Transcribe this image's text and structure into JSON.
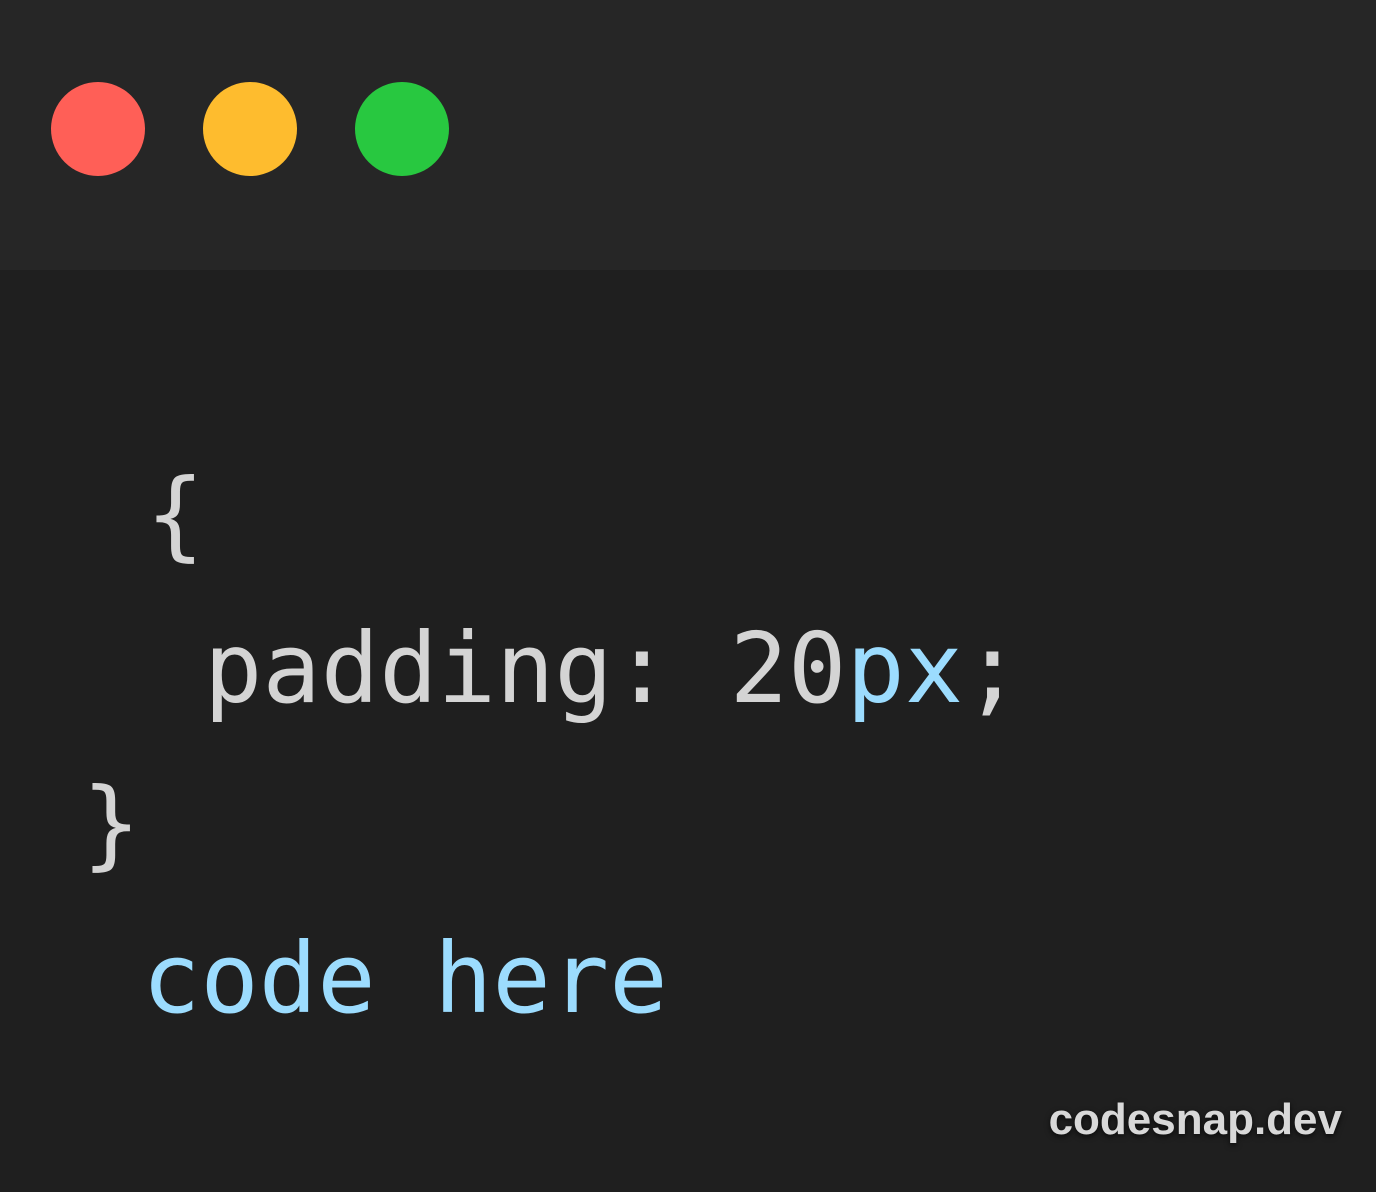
{
  "window": {
    "controls": [
      {
        "name": "close",
        "color": "#ff5f57"
      },
      {
        "name": "minimize",
        "color": "#febc2e"
      },
      {
        "name": "maximize",
        "color": "#28c840"
      }
    ]
  },
  "code": {
    "colors": {
      "default": "#d4d4d4",
      "unit": "#9cdcfe"
    },
    "lines": [
      {
        "tokens": [
          {
            "text": "{",
            "kind": "default"
          }
        ]
      },
      {
        "tokens": [
          {
            "text": "padding: 20",
            "kind": "default"
          },
          {
            "text": "px",
            "kind": "unit"
          },
          {
            "text": ";",
            "kind": "default"
          }
        ]
      },
      {
        "tokens": [
          {
            "text": "}",
            "kind": "default"
          }
        ]
      },
      {
        "tokens": [
          {
            "text": "code here",
            "kind": "unit"
          }
        ]
      }
    ]
  },
  "watermark": {
    "text": "codesnap.dev"
  }
}
